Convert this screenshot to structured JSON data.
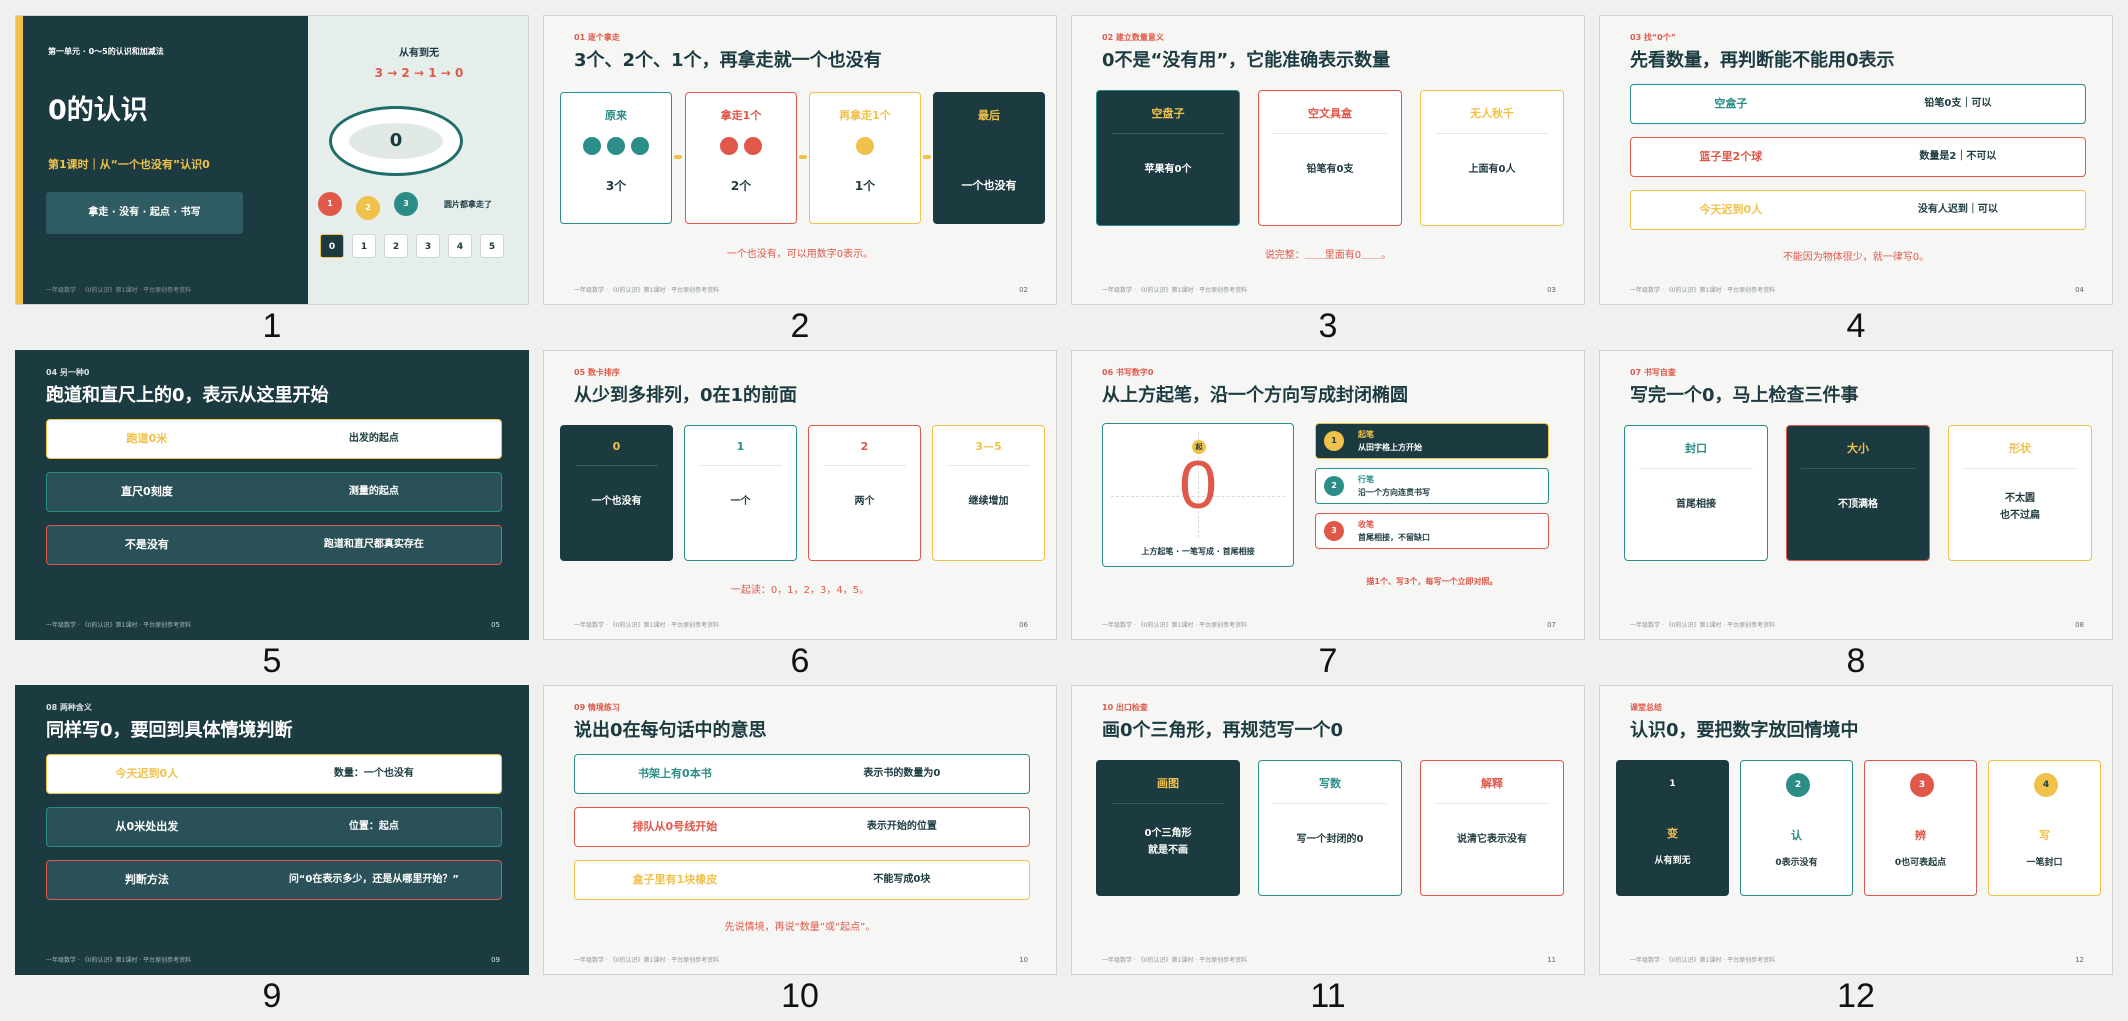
{
  "colors": {
    "teal": "#2a8d87",
    "dark": "#1c3b41",
    "red": "#e0584a",
    "yellow": "#f0c14b",
    "bg": "#f6f7f4"
  },
  "footer": "一年级数学 · 《0的认识》第1课时 · 平台原创参考资料",
  "slide_numbers": [
    "1",
    "2",
    "3",
    "4",
    "5",
    "6",
    "7",
    "8",
    "9",
    "10",
    "11",
    "12"
  ],
  "s1": {
    "unit": "第一单元 · 0～5的认识和加减法",
    "title": "0的认识",
    "subtitle": "第1课时｜从“一个也没有”认识0",
    "keywords": "拿走 · 没有 · 起点 · 书写",
    "side_title": "从有到无",
    "sequence": "3 → 2 → 1 → 0",
    "oval": "0",
    "balls": [
      "1",
      "2",
      "3"
    ],
    "caption": "圆片都拿走了",
    "numbers": [
      "0",
      "1",
      "2",
      "3",
      "4",
      "5"
    ]
  },
  "s2": {
    "kicker": "01 逐个拿走",
    "title": "3个、2个、1个，再拿走就一个也没有",
    "cards": [
      {
        "h": "原来",
        "b": "3个"
      },
      {
        "h": "拿走1个",
        "b": "2个"
      },
      {
        "h": "再拿走1个",
        "b": "1个"
      },
      {
        "h": "最后",
        "b": "一个也没有"
      }
    ],
    "note": "一个也没有，可以用数字0表示。",
    "page": "02"
  },
  "s3": {
    "kicker": "02 建立数量意义",
    "title": "0不是“没有用”，它能准确表示数量",
    "cards": [
      {
        "h": "空盘子",
        "b": "苹果有0个"
      },
      {
        "h": "空文具盒",
        "b": "铅笔有0支"
      },
      {
        "h": "无人秋千",
        "b": "上面有0人"
      }
    ],
    "note": "说完整：＿＿里面有0＿＿。",
    "page": "03"
  },
  "s4": {
    "kicker": "03 找“0个”",
    "title": "先看数量，再判断能不能用0表示",
    "rows": [
      {
        "l": "空盒子",
        "r": "铅笔0支｜可以"
      },
      {
        "l": "篮子里2个球",
        "r": "数量是2｜不可以"
      },
      {
        "l": "今天迟到0人",
        "r": "没有人迟到｜可以"
      }
    ],
    "note": "不能因为物体很少，就一律写0。",
    "page": "04"
  },
  "s5": {
    "kicker": "04 另一种0",
    "title": "跑道和直尺上的0，表示从这里开始",
    "rows": [
      {
        "l": "跑道0米",
        "r": "出发的起点"
      },
      {
        "l": "直尺0刻度",
        "r": "测量的起点"
      },
      {
        "l": "不是没有",
        "r": "跑道和直尺都真实存在"
      }
    ],
    "page": "05"
  },
  "s6": {
    "kicker": "05 数卡排序",
    "title": "从少到多排列，0在1的前面",
    "cards": [
      {
        "h": "0",
        "b": "一个也没有"
      },
      {
        "h": "1",
        "b": "一个"
      },
      {
        "h": "2",
        "b": "两个"
      },
      {
        "h": "3—5",
        "b": "继续增加"
      }
    ],
    "note": "一起读：0，1，2，3，4，5。",
    "page": "06"
  },
  "s7": {
    "kicker": "06 书写数字0",
    "title": "从上方起笔，沿一个方向写成封闭椭圆",
    "start": "起",
    "digit": "0",
    "caption": "上方起笔 · 一笔写成 · 首尾相接",
    "steps": [
      {
        "n": "1",
        "h": "起笔",
        "b": "从田字格上方开始"
      },
      {
        "n": "2",
        "h": "行笔",
        "b": "沿一个方向连贯书写"
      },
      {
        "n": "3",
        "h": "收笔",
        "b": "首尾相接，不留缺口"
      }
    ],
    "note": "描1个、写3个，每写一个立即对照。",
    "page": "07"
  },
  "s8": {
    "kicker": "07 书写自查",
    "title": "写完一个0，马上检查三件事",
    "cards": [
      {
        "h": "封口",
        "b": "首尾相接"
      },
      {
        "h": "大小",
        "b": "不顶满格"
      },
      {
        "h": "形状",
        "b": "不太圆",
        "b2": "也不过扁"
      }
    ],
    "page": "08"
  },
  "s9": {
    "kicker": "08 两种含义",
    "title": "同样写0，要回到具体情境判断",
    "rows": [
      {
        "l": "今天迟到0人",
        "r": "数量：一个也没有"
      },
      {
        "l": "从0米处出发",
        "r": "位置：起点"
      },
      {
        "l": "判断方法",
        "r": "问“0在表示多少，还是从哪里开始？”"
      }
    ],
    "page": "09"
  },
  "s10": {
    "kicker": "09 情境练习",
    "title": "说出0在每句话中的意思",
    "rows": [
      {
        "l": "书架上有0本书",
        "r": "表示书的数量为0"
      },
      {
        "l": "排队从0号线开始",
        "r": "表示开始的位置"
      },
      {
        "l": "盒子里有1块橡皮",
        "r": "不能写成0块"
      }
    ],
    "note": "先说情境，再说“数量”或“起点”。",
    "page": "10"
  },
  "s11": {
    "kicker": "10 出口检查",
    "title": "画0个三角形，再规范写一个0",
    "cards": [
      {
        "h": "画图",
        "b": "0个三角形",
        "b2": "就是不画"
      },
      {
        "h": "写数",
        "b": "写一个封闭的0"
      },
      {
        "h": "解释",
        "b": "说清它表示没有"
      }
    ],
    "page": "11"
  },
  "s12": {
    "kicker": "课堂总结",
    "title": "认识0，要把数字放回情境中",
    "cards": [
      {
        "n": "1",
        "h": "变",
        "b": "从有到无"
      },
      {
        "n": "2",
        "h": "认",
        "b": "0表示没有"
      },
      {
        "n": "3",
        "h": "辨",
        "b": "0也可表起点"
      },
      {
        "n": "4",
        "h": "写",
        "b": "一笔封口"
      }
    ],
    "page": "12"
  }
}
